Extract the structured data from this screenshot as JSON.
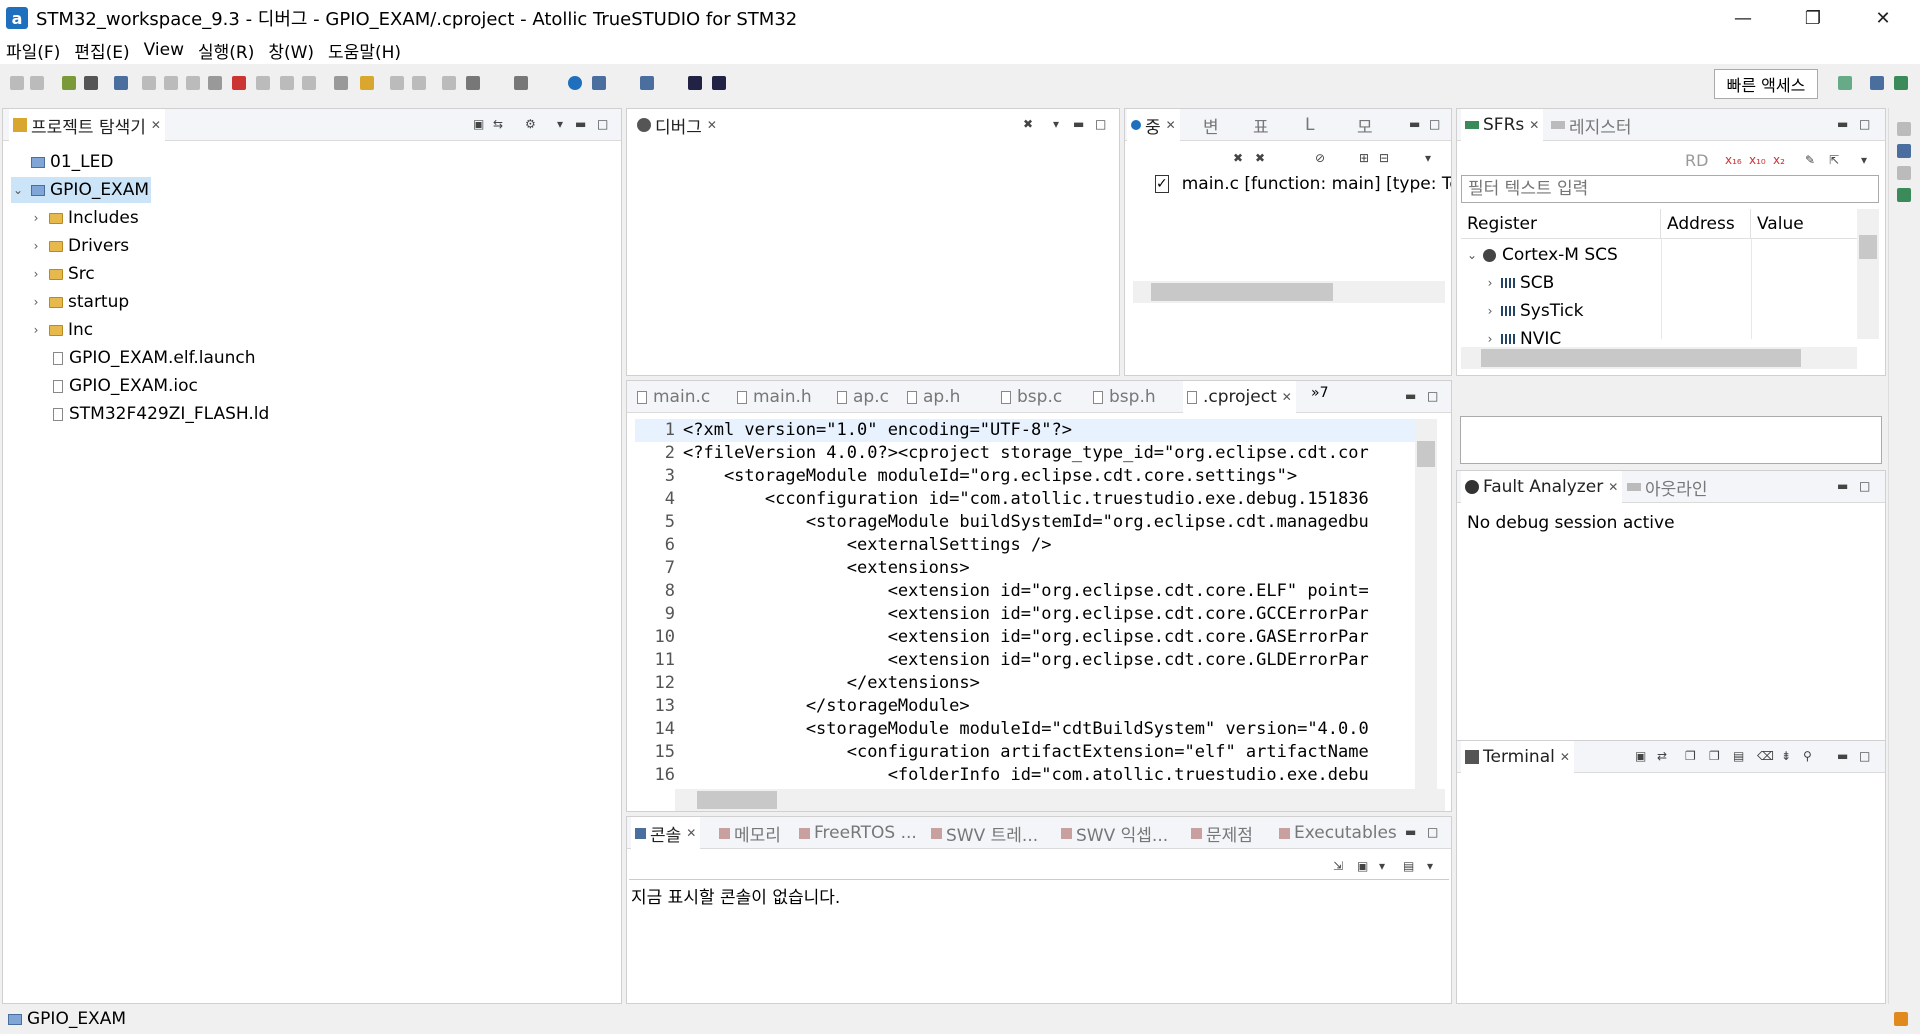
{
  "window": {
    "title": "STM32_workspace_9.3 - 디버그 - GPIO_EXAM/.cproject - Atollic TrueSTUDIO for STM32",
    "logo_letter": "a"
  },
  "menu": [
    "파일(F)",
    "편집(E)",
    "View",
    "실행(R)",
    "창(W)",
    "도움말(H)"
  ],
  "toolbar": {
    "quick_access": "빠른 액세스"
  },
  "project_explorer": {
    "tab_label": "프로젝트 탐색기",
    "items": [
      {
        "label": "01_LED",
        "type": "project",
        "twisty": ""
      },
      {
        "label": "GPIO_EXAM",
        "type": "project",
        "twisty": "⌄"
      },
      {
        "label": "Includes",
        "type": "folder",
        "twisty": "›"
      },
      {
        "label": "Drivers",
        "type": "folder",
        "twisty": "›"
      },
      {
        "label": "Src",
        "type": "folder",
        "twisty": "›"
      },
      {
        "label": "startup",
        "type": "folder",
        "twisty": "›"
      },
      {
        "label": "Inc",
        "type": "folder",
        "twisty": "›"
      },
      {
        "label": "GPIO_EXAM.elf.launch",
        "type": "file",
        "twisty": ""
      },
      {
        "label": "GPIO_EXAM.ioc",
        "type": "file",
        "twisty": ""
      },
      {
        "label": "STM32F429ZI_FLASH.ld",
        "type": "file",
        "twisty": ""
      }
    ]
  },
  "debug_panel": {
    "tab_label": "디버그"
  },
  "breakpoints_panel": {
    "tabs": [
      "중",
      "변",
      "표",
      "L",
      "모"
    ],
    "entry": "main.c [function: main] [type: Te"
  },
  "sfr_panel": {
    "tabs": [
      "SFRs",
      "레지스터"
    ],
    "rd_label": "RD",
    "filter_placeholder": "필터 텍스트 입력",
    "columns": [
      "Register",
      "Address",
      "Value"
    ],
    "rows": [
      {
        "label": "Cortex-M SCS",
        "twisty": "⌄"
      },
      {
        "label": "SCB",
        "twisty": "›"
      },
      {
        "label": "SysTick",
        "twisty": "›"
      },
      {
        "label": "NVIC",
        "twisty": "›"
      }
    ]
  },
  "editor": {
    "tabs": [
      "main.c",
      "main.h",
      "ap.c",
      "ap.h",
      "bsp.c",
      "bsp.h",
      ".cproject"
    ],
    "active_tab": ".cproject",
    "overflow_label": "»7",
    "lines": [
      {
        "no": "1",
        "text": "<?xml version=\"1.0\" encoding=\"UTF-8\"?>"
      },
      {
        "no": "2",
        "text": "<?fileVersion 4.0.0?><cproject storage_type_id=\"org.eclipse.cdt.cor"
      },
      {
        "no": "3",
        "text": "    <storageModule moduleId=\"org.eclipse.cdt.core.settings\">"
      },
      {
        "no": "4",
        "text": "        <cconfiguration id=\"com.atollic.truestudio.exe.debug.151836"
      },
      {
        "no": "5",
        "text": "            <storageModule buildSystemId=\"org.eclipse.cdt.managedbu"
      },
      {
        "no": "6",
        "text": "                <externalSettings />"
      },
      {
        "no": "7",
        "text": "                <extensions>"
      },
      {
        "no": "8",
        "text": "                    <extension id=\"org.eclipse.cdt.core.ELF\" point="
      },
      {
        "no": "9",
        "text": "                    <extension id=\"org.eclipse.cdt.core.GCCErrorPar"
      },
      {
        "no": "10",
        "text": "                    <extension id=\"org.eclipse.cdt.core.GASErrorPar"
      },
      {
        "no": "11",
        "text": "                    <extension id=\"org.eclipse.cdt.core.GLDErrorPar"
      },
      {
        "no": "12",
        "text": "                </extensions>"
      },
      {
        "no": "13",
        "text": "            </storageModule>"
      },
      {
        "no": "14",
        "text": "            <storageModule moduleId=\"cdtBuildSystem\" version=\"4.0.0"
      },
      {
        "no": "15",
        "text": "                <configuration artifactExtension=\"elf\" artifactName"
      },
      {
        "no": "16",
        "text": "                    <folderInfo id=\"com.atollic.truestudio.exe.debu"
      }
    ]
  },
  "console_panel": {
    "tabs": [
      "콘솔",
      "메모리",
      "FreeRTOS ...",
      "SWV 트레...",
      "SWV 익셉...",
      "문제점",
      "Executables"
    ],
    "message": "지금 표시할 콘솔이 없습니다."
  },
  "fault_panel": {
    "tabs": [
      "Fault Analyzer",
      "아웃라인"
    ],
    "message": "No debug session active"
  },
  "terminal_panel": {
    "tab_label": "Terminal"
  },
  "status_bar": {
    "selection": "GPIO_EXAM"
  },
  "colors": {
    "selection": "#cce4f7",
    "tabbar": "#f3f5f9",
    "accent": "#1f6fbf"
  }
}
